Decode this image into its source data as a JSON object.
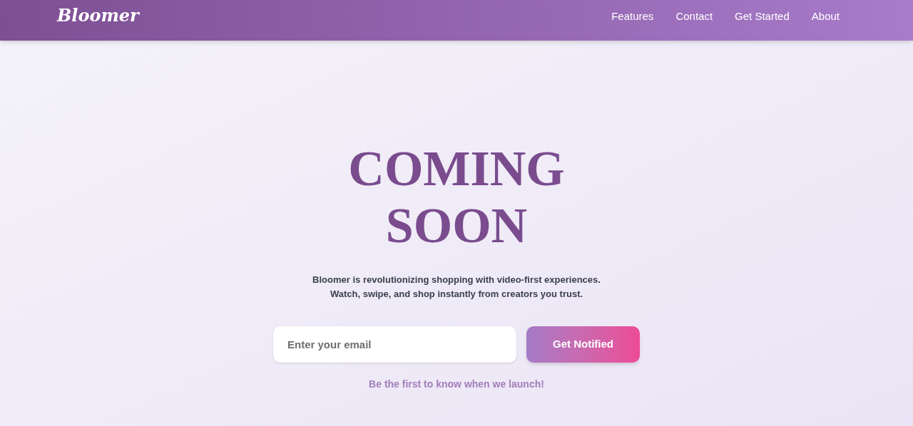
{
  "header": {
    "logo": "Bloomer",
    "nav": [
      {
        "label": "Features"
      },
      {
        "label": "Contact"
      },
      {
        "label": "Get Started"
      },
      {
        "label": "About"
      }
    ]
  },
  "hero": {
    "title_lines": [
      "COMING",
      "SOON"
    ],
    "description_lines": [
      "Bloomer is revolutionizing shopping with video-first experiences.",
      "Watch, swipe, and shop instantly from creators you trust."
    ],
    "email": {
      "placeholder": "Enter your email"
    },
    "button": "Get Notified",
    "note": "Be the first to know when we launch!"
  }
}
